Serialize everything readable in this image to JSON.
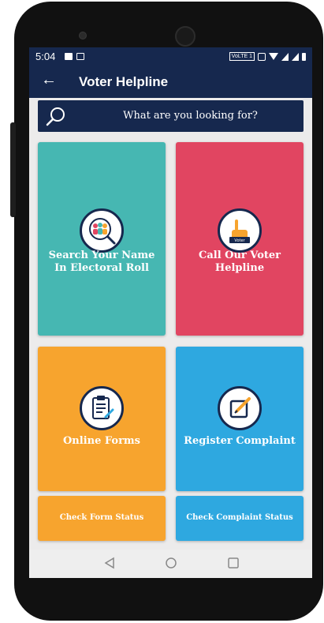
{
  "status_bar": {
    "time": "5:04",
    "volte": "VoLTE 1"
  },
  "app_bar": {
    "back_glyph": "←",
    "title": "Voter Helpline"
  },
  "search": {
    "placeholder": "What are you looking for?"
  },
  "tiles": [
    {
      "label": "Search Your Name In Electoral Roll",
      "icon": "people-search-icon",
      "color": "#46b7b2"
    },
    {
      "label": "Call Our Voter Helpline",
      "icon": "voter-hand-icon",
      "color": "#e14561"
    },
    {
      "label": "Online Forms",
      "icon": "clipboard-icon",
      "color": "#f7a42e"
    },
    {
      "label": "Register Complaint",
      "icon": "edit-icon",
      "color": "#2ea8e0"
    }
  ],
  "status_tiles": [
    {
      "label": "Check Form Status"
    },
    {
      "label": "Check Complaint Status"
    }
  ],
  "nav_bar": [
    "back-nav",
    "home-nav",
    "recents-nav"
  ],
  "colors": {
    "primary": "#16284e",
    "background": "#ecebeb"
  }
}
